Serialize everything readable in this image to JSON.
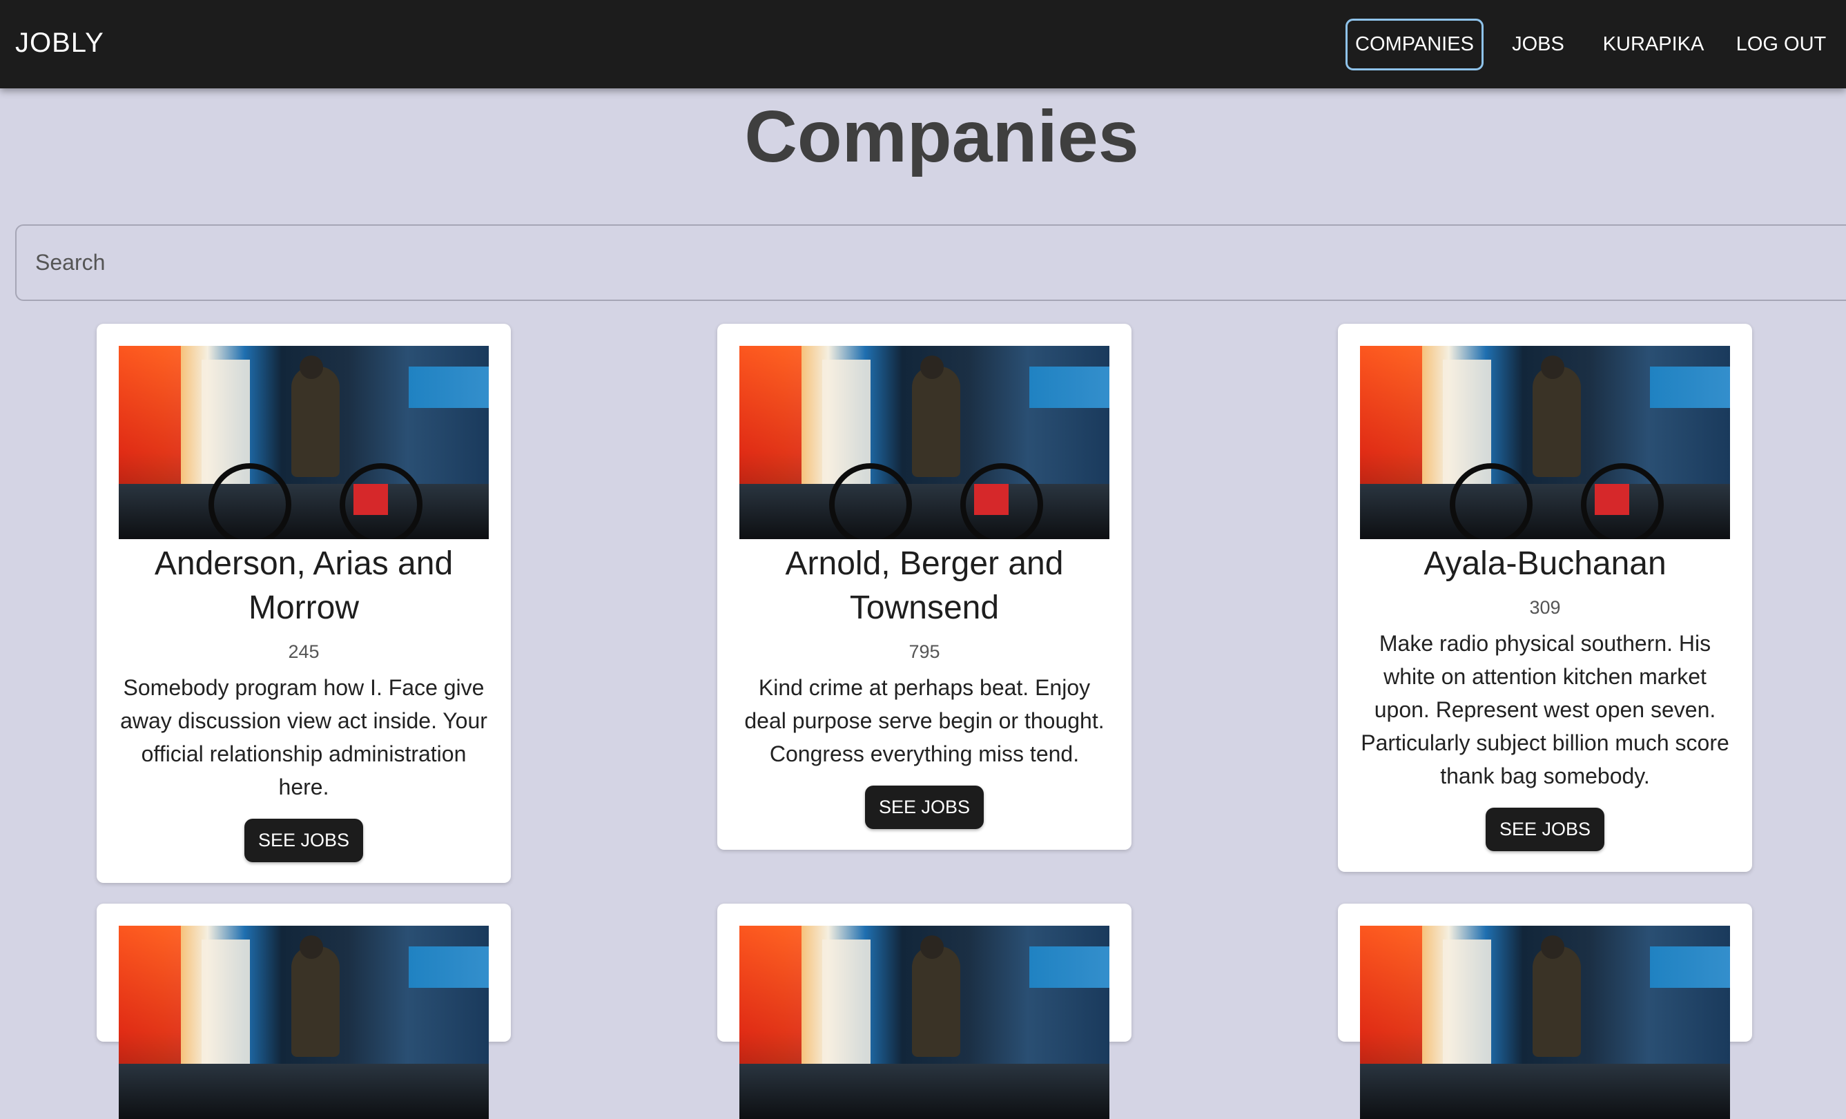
{
  "navbar": {
    "brand": "JOBLY",
    "links": [
      {
        "label": "COMPANIES",
        "active": true
      },
      {
        "label": "JOBS"
      },
      {
        "label": "KURAPIKA"
      },
      {
        "label": "LOG OUT"
      }
    ]
  },
  "page_title": "Companies",
  "search": {
    "placeholder": "Search",
    "value": ""
  },
  "companies": [
    {
      "name": "Anderson, Arias and Morrow",
      "num_employees": "245",
      "description": "Somebody program how I. Face give away discussion view act inside. Your official relationship administration here.",
      "button_label": "SEE JOBS"
    },
    {
      "name": "Arnold, Berger and Townsend",
      "num_employees": "795",
      "description": "Kind crime at perhaps beat. Enjoy deal purpose serve begin or thought. Congress everything miss tend.",
      "button_label": "SEE JOBS"
    },
    {
      "name": "Ayala-Buchanan",
      "num_employees": "309",
      "description": "Make radio physical southern. His white on attention kitchen market upon. Represent west open seven. Particularly subject billion much score thank bag somebody.",
      "button_label": "SEE JOBS"
    }
  ],
  "colors": {
    "navbar_bg": "#1c1c1c",
    "page_bg": "#d4d4e4",
    "active_border": "#8fc3ea",
    "button_bg": "#1c1c1c"
  }
}
